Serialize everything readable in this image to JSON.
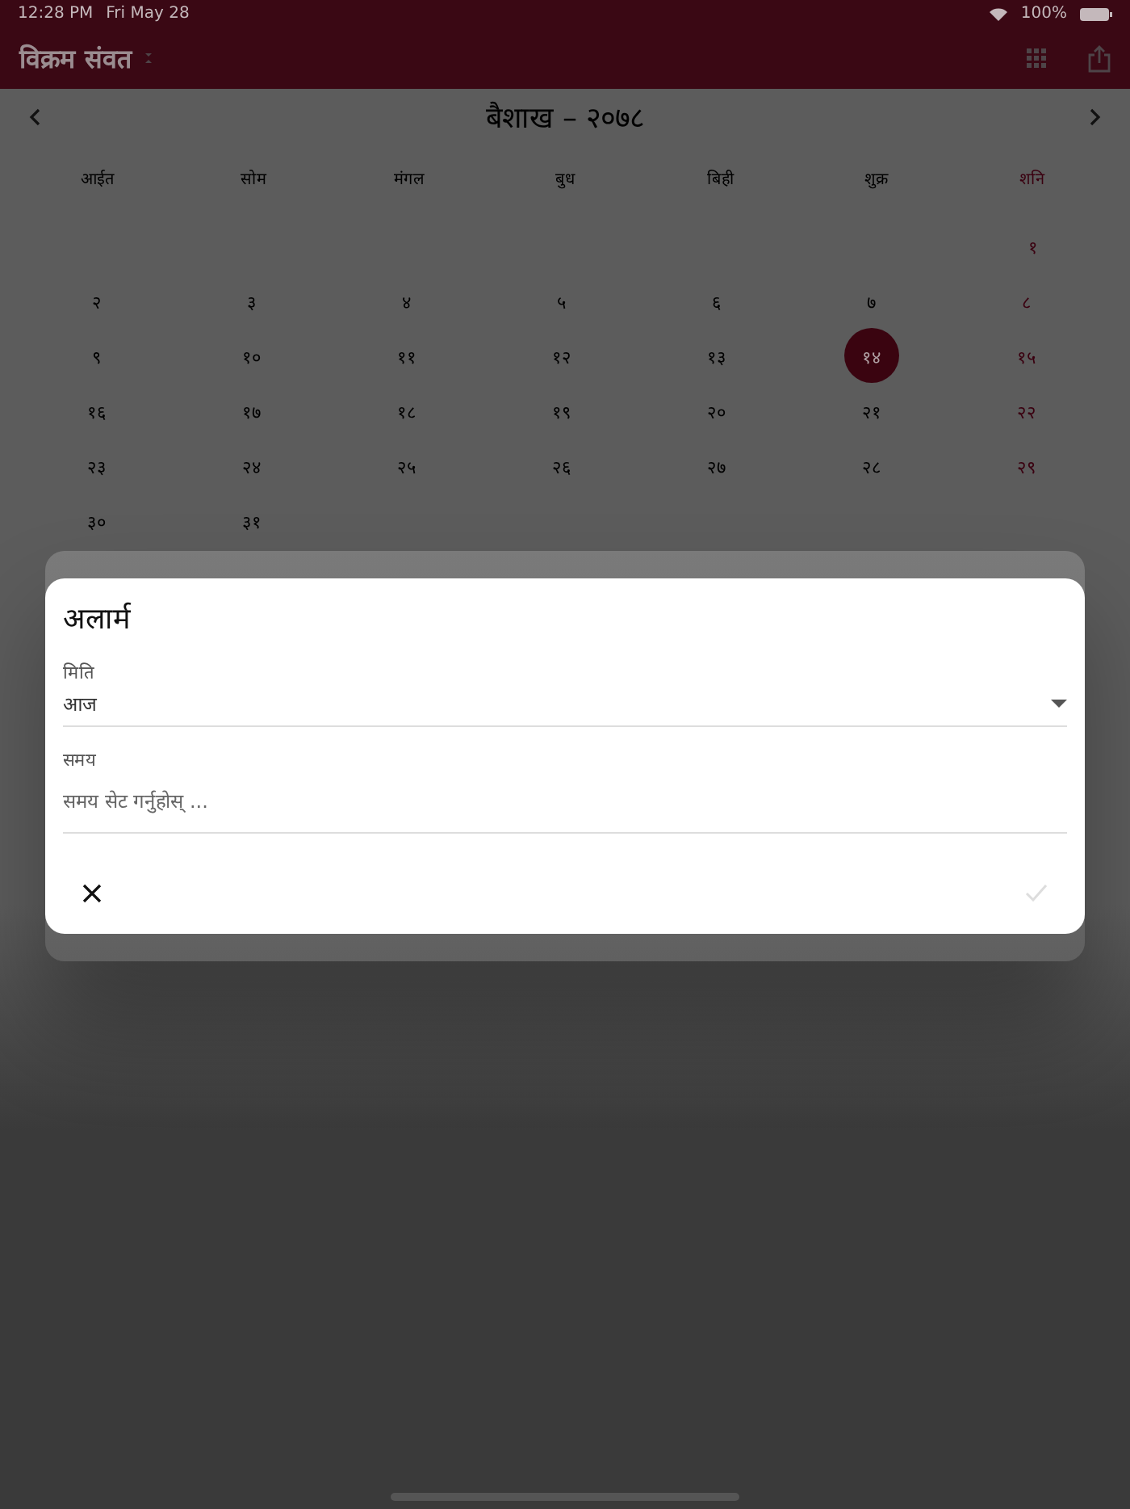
{
  "status_bar": {
    "time": "12:28 PM",
    "date": "Fri May 28",
    "battery": "100%"
  },
  "app_bar": {
    "title": "विक्रम संवत"
  },
  "month_header": {
    "title": "बैशाख – २०७८"
  },
  "weekdays": [
    {
      "label": "आईत",
      "holiday": false
    },
    {
      "label": "सोम",
      "holiday": false
    },
    {
      "label": "मंगल",
      "holiday": false
    },
    {
      "label": "बुध",
      "holiday": false
    },
    {
      "label": "बिही",
      "holiday": false
    },
    {
      "label": "शुक्र",
      "holiday": false
    },
    {
      "label": "शनि",
      "holiday": true
    }
  ],
  "weeks": [
    {
      "days": [
        {
          "label": "१",
          "holiday": true,
          "selected": false
        }
      ]
    },
    {
      "days": [
        {
          "label": "२",
          "holiday": false,
          "selected": false
        },
        {
          "label": "३",
          "holiday": false,
          "selected": false
        },
        {
          "label": "४",
          "holiday": false,
          "selected": false
        },
        {
          "label": "५",
          "holiday": false,
          "selected": false
        },
        {
          "label": "६",
          "holiday": false,
          "selected": false
        },
        {
          "label": "७",
          "holiday": false,
          "selected": false
        },
        {
          "label": "८",
          "holiday": true,
          "selected": false
        }
      ]
    },
    {
      "days": [
        {
          "label": "९",
          "holiday": false,
          "selected": false
        },
        {
          "label": "१०",
          "holiday": false,
          "selected": false
        },
        {
          "label": "११",
          "holiday": false,
          "selected": false
        },
        {
          "label": "१२",
          "holiday": false,
          "selected": false
        },
        {
          "label": "१३",
          "holiday": false,
          "selected": false
        },
        {
          "label": "१४",
          "holiday": false,
          "selected": true
        },
        {
          "label": "१५",
          "holiday": true,
          "selected": false
        }
      ]
    },
    {
      "days": [
        {
          "label": "१६",
          "holiday": false,
          "selected": false
        },
        {
          "label": "१७",
          "holiday": false,
          "selected": false
        },
        {
          "label": "१८",
          "holiday": false,
          "selected": false
        },
        {
          "label": "१९",
          "holiday": false,
          "selected": false
        },
        {
          "label": "२०",
          "holiday": false,
          "selected": false
        },
        {
          "label": "२१",
          "holiday": false,
          "selected": false
        },
        {
          "label": "२२",
          "holiday": true,
          "selected": false
        }
      ]
    },
    {
      "days": [
        {
          "label": "२३",
          "holiday": false,
          "selected": false
        },
        {
          "label": "२४",
          "holiday": false,
          "selected": false
        },
        {
          "label": "२५",
          "holiday": false,
          "selected": false
        },
        {
          "label": "२६",
          "holiday": false,
          "selected": false
        },
        {
          "label": "२७",
          "holiday": false,
          "selected": false
        },
        {
          "label": "२८",
          "holiday": false,
          "selected": false
        },
        {
          "label": "२९",
          "holiday": true,
          "selected": false
        }
      ]
    },
    {
      "days": [
        {
          "label": "३०",
          "holiday": false,
          "selected": false
        },
        {
          "label": "३१",
          "holiday": false,
          "selected": false
        }
      ]
    }
  ],
  "dialog": {
    "title": "अलार्म",
    "fields": [
      {
        "kind": "select",
        "label": "मिति",
        "value": "आज"
      },
      {
        "kind": "text",
        "label": "समय",
        "placeholder": "समय सेट गर्नुहोस् ..."
      }
    ],
    "confirm": {
      "disabled": true
    }
  }
}
